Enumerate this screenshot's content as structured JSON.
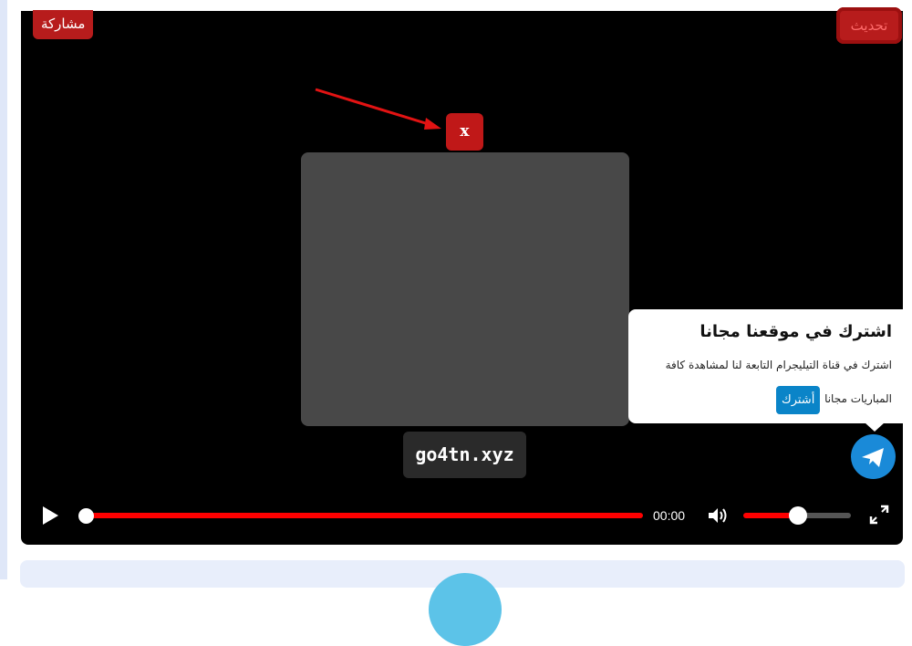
{
  "player": {
    "share_label": "مشاركة",
    "refresh_label": "تحديث",
    "close_label": "x",
    "watermark": "go4tn.xyz"
  },
  "subscribe_card": {
    "title": "اشترك في موقعنا مجانا",
    "text_line1": "اشترك في قناة التيليجرام التابعة لنا لمشاهدة كافة",
    "text_line2": "المباريات مجانا",
    "button_label": "أشترك"
  },
  "controls": {
    "current_time": "00:00",
    "progress": 0.0,
    "volume": 0.5
  },
  "colors": {
    "accent_red": "#ff0000",
    "button_red": "#b71c1c",
    "telegram_blue": "#1a8ad8",
    "subscribe_blue": "#0a84c8"
  },
  "icons": [
    "play-icon",
    "volume-icon",
    "fullscreen-icon",
    "telegram-icon",
    "arrow-annotation-icon"
  ]
}
